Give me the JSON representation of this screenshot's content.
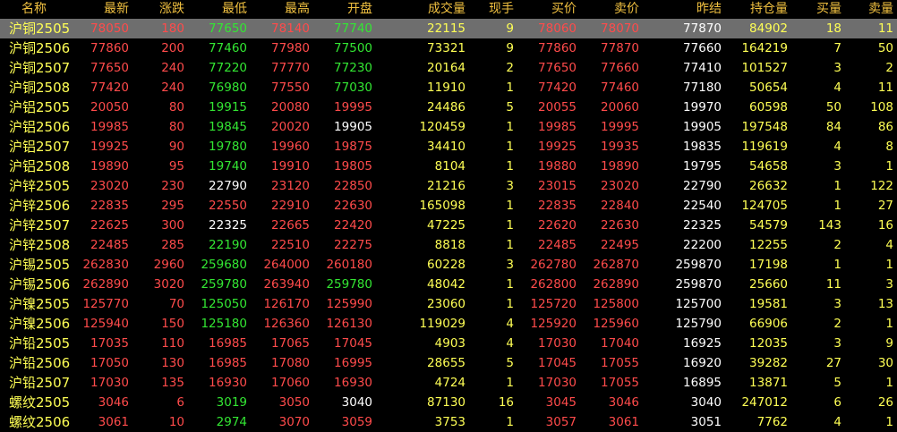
{
  "columns": [
    "名称",
    "最新",
    "涨跌",
    "最低",
    "最高",
    "开盘",
    "成交量",
    "现手",
    "买价",
    "卖价",
    "",
    "昨结",
    "持仓量",
    "买量",
    "卖量"
  ],
  "colors": {
    "red": "#ff4b4b",
    "green": "#33e633",
    "white": "#ffffff",
    "yellow": "#ffff55",
    "header": "#f0c040",
    "selected": "#6e6e6e"
  },
  "selected_row": 0,
  "rows": [
    {
      "name": "沪铜2505",
      "latest": "78050",
      "change": "180",
      "low": "77650",
      "high": "78140",
      "open": "77740",
      "volume": "22115",
      "cur": "9",
      "bid": "78060",
      "ask": "78070",
      "prev": "77870",
      "oi": "84902",
      "bidv": "18",
      "askv": "11",
      "lc": "red",
      "lowc": "green",
      "highc": "red",
      "openc": "green",
      "bidc": "red",
      "askc": "red"
    },
    {
      "name": "沪铜2506",
      "latest": "77860",
      "change": "200",
      "low": "77460",
      "high": "77980",
      "open": "77500",
      "volume": "73321",
      "cur": "9",
      "bid": "77860",
      "ask": "77870",
      "prev": "77660",
      "oi": "164219",
      "bidv": "7",
      "askv": "50",
      "lc": "red",
      "lowc": "green",
      "highc": "red",
      "openc": "green",
      "bidc": "red",
      "askc": "red"
    },
    {
      "name": "沪铜2507",
      "latest": "77650",
      "change": "240",
      "low": "77220",
      "high": "77770",
      "open": "77230",
      "volume": "20164",
      "cur": "2",
      "bid": "77650",
      "ask": "77660",
      "prev": "77410",
      "oi": "101527",
      "bidv": "3",
      "askv": "2",
      "lc": "red",
      "lowc": "green",
      "highc": "red",
      "openc": "green",
      "bidc": "red",
      "askc": "red"
    },
    {
      "name": "沪铜2508",
      "latest": "77420",
      "change": "240",
      "low": "76980",
      "high": "77550",
      "open": "77030",
      "volume": "11910",
      "cur": "1",
      "bid": "77420",
      "ask": "77460",
      "prev": "77180",
      "oi": "50654",
      "bidv": "4",
      "askv": "11",
      "lc": "red",
      "lowc": "green",
      "highc": "red",
      "openc": "green",
      "bidc": "red",
      "askc": "red"
    },
    {
      "name": "沪铝2505",
      "latest": "20050",
      "change": "80",
      "low": "19915",
      "high": "20080",
      "open": "19995",
      "volume": "24486",
      "cur": "5",
      "bid": "20055",
      "ask": "20060",
      "prev": "19970",
      "oi": "60598",
      "bidv": "50",
      "askv": "108",
      "lc": "red",
      "lowc": "green",
      "highc": "red",
      "openc": "red",
      "bidc": "red",
      "askc": "red"
    },
    {
      "name": "沪铝2506",
      "latest": "19985",
      "change": "80",
      "low": "19845",
      "high": "20020",
      "open": "19905",
      "volume": "120459",
      "cur": "1",
      "bid": "19985",
      "ask": "19995",
      "prev": "19905",
      "oi": "197548",
      "bidv": "84",
      "askv": "86",
      "lc": "red",
      "lowc": "green",
      "highc": "red",
      "openc": "white",
      "bidc": "red",
      "askc": "red"
    },
    {
      "name": "沪铝2507",
      "latest": "19925",
      "change": "90",
      "low": "19780",
      "high": "19960",
      "open": "19875",
      "volume": "34410",
      "cur": "1",
      "bid": "19925",
      "ask": "19935",
      "prev": "19835",
      "oi": "119619",
      "bidv": "4",
      "askv": "8",
      "lc": "red",
      "lowc": "green",
      "highc": "red",
      "openc": "red",
      "bidc": "red",
      "askc": "red"
    },
    {
      "name": "沪铝2508",
      "latest": "19890",
      "change": "95",
      "low": "19740",
      "high": "19910",
      "open": "19805",
      "volume": "8104",
      "cur": "1",
      "bid": "19880",
      "ask": "19890",
      "prev": "19795",
      "oi": "54658",
      "bidv": "3",
      "askv": "1",
      "lc": "red",
      "lowc": "green",
      "highc": "red",
      "openc": "red",
      "bidc": "red",
      "askc": "red"
    },
    {
      "name": "沪锌2505",
      "latest": "23020",
      "change": "230",
      "low": "22790",
      "high": "23120",
      "open": "22850",
      "volume": "21216",
      "cur": "3",
      "bid": "23015",
      "ask": "23020",
      "prev": "22790",
      "oi": "26632",
      "bidv": "1",
      "askv": "122",
      "lc": "red",
      "lowc": "white",
      "highc": "red",
      "openc": "red",
      "bidc": "red",
      "askc": "red"
    },
    {
      "name": "沪锌2506",
      "latest": "22835",
      "change": "295",
      "low": "22550",
      "high": "22910",
      "open": "22630",
      "volume": "165098",
      "cur": "1",
      "bid": "22835",
      "ask": "22840",
      "prev": "22540",
      "oi": "124705",
      "bidv": "1",
      "askv": "27",
      "lc": "red",
      "lowc": "red",
      "highc": "red",
      "openc": "red",
      "bidc": "red",
      "askc": "red"
    },
    {
      "name": "沪锌2507",
      "latest": "22625",
      "change": "300",
      "low": "22325",
      "high": "22665",
      "open": "22420",
      "volume": "47225",
      "cur": "1",
      "bid": "22620",
      "ask": "22630",
      "prev": "22325",
      "oi": "54579",
      "bidv": "143",
      "askv": "16",
      "lc": "red",
      "lowc": "white",
      "highc": "red",
      "openc": "red",
      "bidc": "red",
      "askc": "red"
    },
    {
      "name": "沪锌2508",
      "latest": "22485",
      "change": "285",
      "low": "22190",
      "high": "22510",
      "open": "22275",
      "volume": "8818",
      "cur": "1",
      "bid": "22485",
      "ask": "22495",
      "prev": "22200",
      "oi": "12255",
      "bidv": "2",
      "askv": "4",
      "lc": "red",
      "lowc": "green",
      "highc": "red",
      "openc": "red",
      "bidc": "red",
      "askc": "red"
    },
    {
      "name": "沪锡2505",
      "latest": "262830",
      "change": "2960",
      "low": "259680",
      "high": "264000",
      "open": "260180",
      "volume": "60228",
      "cur": "3",
      "bid": "262780",
      "ask": "262870",
      "prev": "259870",
      "oi": "17198",
      "bidv": "1",
      "askv": "1",
      "lc": "red",
      "lowc": "green",
      "highc": "red",
      "openc": "red",
      "bidc": "red",
      "askc": "red"
    },
    {
      "name": "沪锡2506",
      "latest": "262890",
      "change": "3020",
      "low": "259780",
      "high": "263940",
      "open": "259780",
      "volume": "48042",
      "cur": "1",
      "bid": "262800",
      "ask": "262890",
      "prev": "259870",
      "oi": "25660",
      "bidv": "11",
      "askv": "3",
      "lc": "red",
      "lowc": "green",
      "highc": "red",
      "openc": "green",
      "bidc": "red",
      "askc": "red"
    },
    {
      "name": "沪镍2505",
      "latest": "125770",
      "change": "70",
      "low": "125050",
      "high": "126170",
      "open": "125990",
      "volume": "23060",
      "cur": "1",
      "bid": "125720",
      "ask": "125800",
      "prev": "125700",
      "oi": "19581",
      "bidv": "3",
      "askv": "13",
      "lc": "red",
      "lowc": "green",
      "highc": "red",
      "openc": "red",
      "bidc": "red",
      "askc": "red"
    },
    {
      "name": "沪镍2506",
      "latest": "125940",
      "change": "150",
      "low": "125180",
      "high": "126360",
      "open": "126130",
      "volume": "119029",
      "cur": "4",
      "bid": "125920",
      "ask": "125960",
      "prev": "125790",
      "oi": "66906",
      "bidv": "2",
      "askv": "1",
      "lc": "red",
      "lowc": "green",
      "highc": "red",
      "openc": "red",
      "bidc": "red",
      "askc": "red"
    },
    {
      "name": "沪铅2505",
      "latest": "17035",
      "change": "110",
      "low": "16985",
      "high": "17065",
      "open": "17045",
      "volume": "4903",
      "cur": "4",
      "bid": "17030",
      "ask": "17040",
      "prev": "16925",
      "oi": "12035",
      "bidv": "3",
      "askv": "9",
      "lc": "red",
      "lowc": "red",
      "highc": "red",
      "openc": "red",
      "bidc": "red",
      "askc": "red"
    },
    {
      "name": "沪铅2506",
      "latest": "17050",
      "change": "130",
      "low": "16985",
      "high": "17080",
      "open": "16995",
      "volume": "28655",
      "cur": "5",
      "bid": "17045",
      "ask": "17055",
      "prev": "16920",
      "oi": "39282",
      "bidv": "27",
      "askv": "30",
      "lc": "red",
      "lowc": "red",
      "highc": "red",
      "openc": "red",
      "bidc": "red",
      "askc": "red"
    },
    {
      "name": "沪铅2507",
      "latest": "17030",
      "change": "135",
      "low": "16930",
      "high": "17060",
      "open": "16930",
      "volume": "4724",
      "cur": "1",
      "bid": "17030",
      "ask": "17055",
      "prev": "16895",
      "oi": "13871",
      "bidv": "5",
      "askv": "1",
      "lc": "red",
      "lowc": "red",
      "highc": "red",
      "openc": "red",
      "bidc": "red",
      "askc": "red"
    },
    {
      "name": "螺纹2505",
      "latest": "3046",
      "change": "6",
      "low": "3019",
      "high": "3050",
      "open": "3040",
      "volume": "87130",
      "cur": "16",
      "bid": "3045",
      "ask": "3046",
      "prev": "3040",
      "oi": "247012",
      "bidv": "6",
      "askv": "26",
      "lc": "red",
      "lowc": "green",
      "highc": "red",
      "openc": "white",
      "bidc": "red",
      "askc": "red"
    },
    {
      "name": "螺纹2506",
      "latest": "3061",
      "change": "10",
      "low": "2974",
      "high": "3070",
      "open": "3059",
      "volume": "3753",
      "cur": "1",
      "bid": "3057",
      "ask": "3061",
      "prev": "3051",
      "oi": "7762",
      "bidv": "4",
      "askv": "1",
      "lc": "red",
      "lowc": "green",
      "highc": "red",
      "openc": "red",
      "bidc": "red",
      "askc": "red"
    }
  ]
}
